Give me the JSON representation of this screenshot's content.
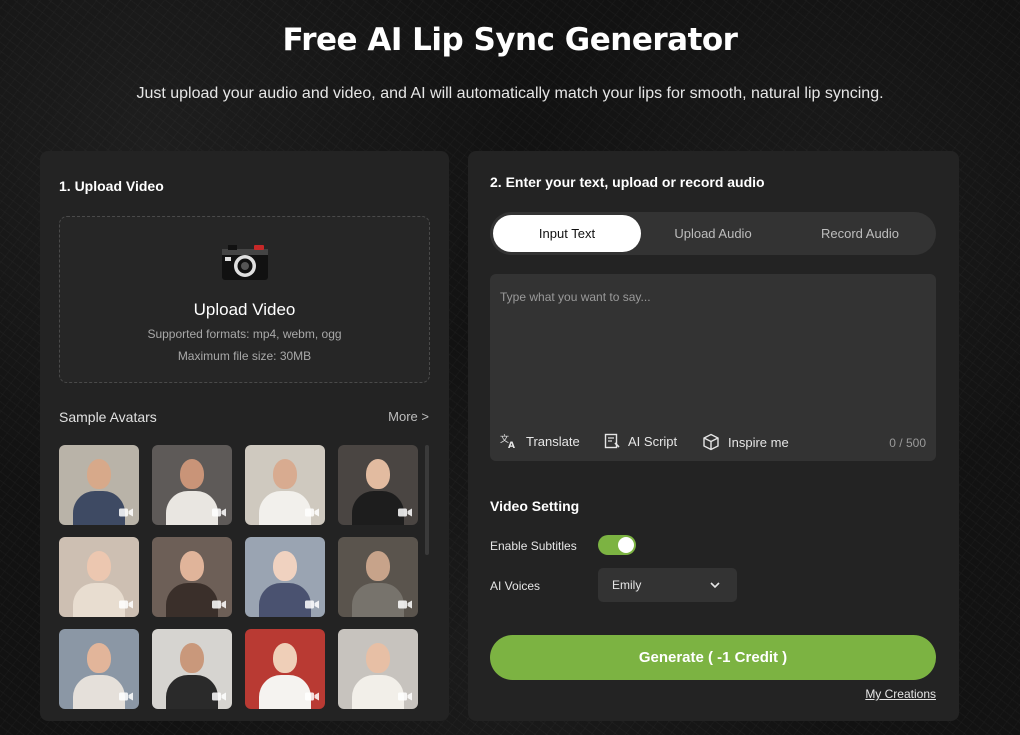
{
  "header": {
    "title": "Free AI Lip Sync Generator",
    "subtitle": "Just upload your audio and video, and AI will automatically match your lips for smooth, natural lip syncing."
  },
  "upload_panel": {
    "heading": "1. Upload Video",
    "box_title": "Upload Video",
    "formats": "Supported formats: mp4, webm, ogg",
    "max_size": "Maximum file size: 30MB"
  },
  "avatars": {
    "heading": "Sample Avatars",
    "more": "More >",
    "tiles": [
      {
        "bg": "#b9b3a8",
        "skin": "#d7a98a",
        "cloth": "#3e4a63"
      },
      {
        "bg": "#5e5a58",
        "skin": "#c99478",
        "cloth": "#e9e6e1"
      },
      {
        "bg": "#cfc9bf",
        "skin": "#d8ab90",
        "cloth": "#f2f0ec"
      },
      {
        "bg": "#4a4542",
        "skin": "#e2bba0",
        "cloth": "#1d1d1d"
      },
      {
        "bg": "#cdbfb2",
        "skin": "#ecc7b0",
        "cloth": "#e8ddd0"
      },
      {
        "bg": "#6d5f57",
        "skin": "#e0b49a",
        "cloth": "#3a2f2a"
      },
      {
        "bg": "#9aa4b2",
        "skin": "#f0d2c0",
        "cloth": "#4a5270"
      },
      {
        "bg": "#5a544d",
        "skin": "#c7a38a",
        "cloth": "#77736c"
      },
      {
        "bg": "#8b97a5",
        "skin": "#e2b59a",
        "cloth": "#e5e0da"
      },
      {
        "bg": "#d6d4d0",
        "skin": "#c9987b",
        "cloth": "#2a2a2a"
      },
      {
        "bg": "#b93a33",
        "skin": "#efcfb8",
        "cloth": "#f5f3f0"
      },
      {
        "bg": "#c7c3be",
        "skin": "#e7bfa5",
        "cloth": "#f2efe9"
      }
    ]
  },
  "audio_panel": {
    "heading": "2. Enter your text, upload or record audio",
    "tabs": [
      {
        "label": "Input Text"
      },
      {
        "label": "Upload Audio"
      },
      {
        "label": "Record Audio"
      }
    ],
    "placeholder": "Type what you want to say...",
    "tools": {
      "translate": "Translate",
      "ai_script": "AI Script",
      "inspire": "Inspire me"
    },
    "char_count": "0 / 500"
  },
  "video_setting": {
    "heading": "Video Setting",
    "subtitles_label": "Enable Subtitles",
    "subtitles_on": true,
    "voices_label": "AI Voices",
    "voice_selected": "Emily"
  },
  "actions": {
    "generate": "Generate ( -1 Credit )",
    "my_creations": "My Creations"
  },
  "colors": {
    "accent": "#7cb342",
    "panel": "#232323",
    "field": "#333333"
  }
}
